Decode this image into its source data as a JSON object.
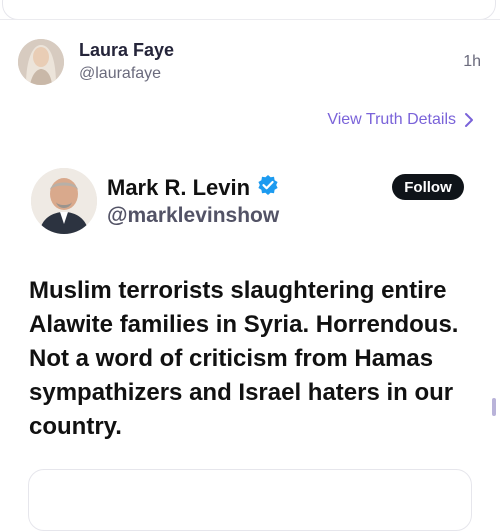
{
  "post": {
    "author_name": "Laura Faye",
    "author_handle": "@laurafaye",
    "time": "1h",
    "view_details_label": "View Truth Details"
  },
  "embedded": {
    "author_name": "Mark R. Levin",
    "author_handle": "@marklevinshow",
    "follow_label": "Follow",
    "text": "Muslim terrorists slaughtering entire Alawite families in Syria. Horrendous. Not a word of criticism from Hamas sympathizers and Israel haters in our country.",
    "verified": true
  },
  "icons": {
    "chevron": "chevron-right-icon",
    "verified": "verified-badge-icon"
  },
  "colors": {
    "accent": "#7a63d9",
    "verified": "#1d9bf0",
    "follow_bg": "#0f1419"
  }
}
